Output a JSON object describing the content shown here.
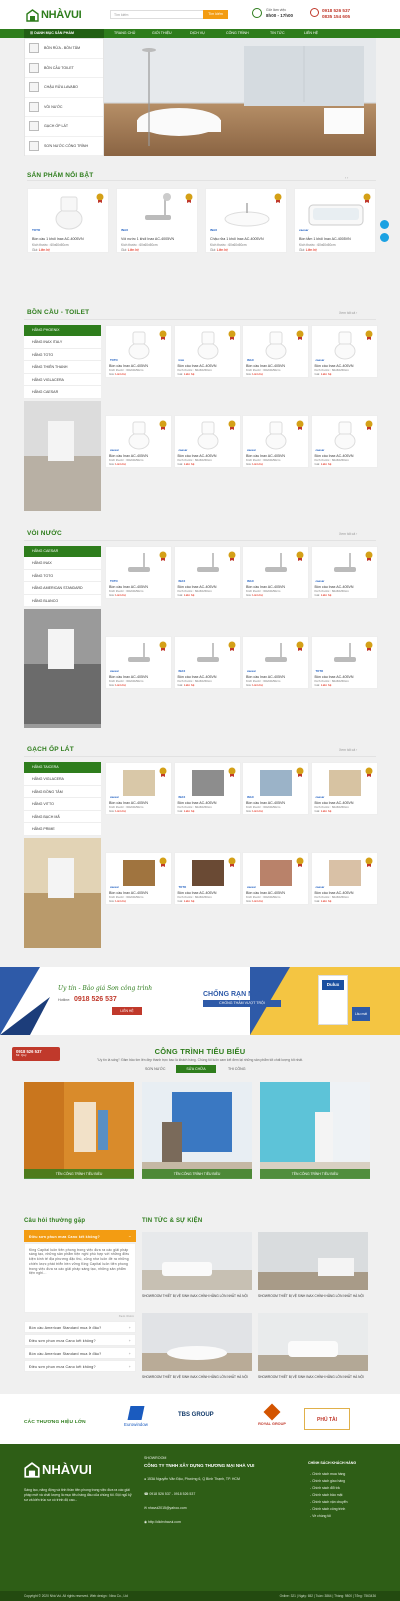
{
  "header": {
    "logo": "NHÀVUI",
    "search_placeholder": "Tìm kiếm",
    "search_button": "Tìm kiếm",
    "hours_label": "Giờ làm việc",
    "hours_value": "8h00 - 17h00",
    "phones": [
      "0918 526 537",
      "0835 154 605"
    ]
  },
  "nav": {
    "category": "DANH MỤC SẢN PHẨM",
    "items": [
      "TRANG CHỦ",
      "GIỚI THIỆU",
      "DỊCH VỤ",
      "CÔNG TRÌNH",
      "TIN TỨC",
      "LIÊN HỆ"
    ]
  },
  "sidebar": {
    "items": [
      "BỒN RỬA - BỒN TẮM",
      "BỒN CẦU TOILET",
      "CHẬU RỬA LAVABO",
      "VÒI NƯỚC",
      "GẠCH ỐP LÁT",
      "SƠN NƯỚC CÔNG TRÌNH"
    ]
  },
  "featured": {
    "title": "SẢN PHẨM NỔI BẬT",
    "products": [
      {
        "name": "Bồn cầu 1 khối Inax AC-4005VN",
        "size": "Kích thước : 60x60x50cm",
        "price_label": "Giá:",
        "price": "Liên hệ",
        "brand": "TOTO"
      },
      {
        "name": "Vòi nước 1 khối Inax AC-4005VN",
        "size": "Kích thước : 60x60x50cm",
        "price_label": "Giá:",
        "price": "Liên hệ",
        "brand": "INAX"
      },
      {
        "name": "Chậu rửa 1 khối Inax AC-4005VN",
        "size": "Kích thước : 60x60x50cm",
        "price_label": "Giá:",
        "price": "Liên hệ",
        "brand": "INAX"
      },
      {
        "name": "Bồn tắm 1 khối Inax AC-4005VN",
        "size": "Kích thước : 60x60x50cm",
        "price_label": "Giá:",
        "price": "Liên hệ",
        "brand": "caesar"
      }
    ]
  },
  "sections": [
    {
      "title": "BỒN CẦU - TOILET",
      "viewall": "Xem tất cả",
      "brands": [
        "HÃNG PHOENIX",
        "HÃNG INAX ITALY",
        "HÃNG TOTO",
        "HÃNG THIÊN THANH",
        "HÃNG VIGLACERA",
        "HÃNG CAESAR"
      ],
      "product_name": "Bồn cầu Inax AC-405VN",
      "size": "Kích thước : 60x60x50cm",
      "price_label": "Giá:",
      "price": "Liên hệ",
      "brand_tags": [
        "TOTO",
        "inax",
        "INAX",
        "caesar",
        "caesar",
        "caesar",
        "caesar",
        "caesar"
      ]
    },
    {
      "title": "VÒI NƯỚC",
      "viewall": "Xem tất cả",
      "brands": [
        "HÃNG CAESAR",
        "HÃNG INAX",
        "HÃNG TOTO",
        "HÃNG AMERICAN STANDARD",
        "HÃNG BLANCO"
      ],
      "product_name": "Bồn cầu Inax AC-405VN",
      "size": "Kích thước : 60x60x50cm",
      "price_label": "Giá:",
      "price": "Liên hệ",
      "brand_tags": [
        "TOTO",
        "INAX",
        "INAX",
        "caesar",
        "caesar",
        "INAX",
        "caesar",
        "TOTO"
      ]
    },
    {
      "title": "GẠCH ỐP LÁT",
      "viewall": "Xem tất cả",
      "brands": [
        "HÃNG TAICERA",
        "HÃNG VIGLACERA",
        "HÃNG ĐỒNG TÂM",
        "HÃNG VITTO",
        "HÃNG BẠCH MÃ",
        "HÃNG PRIME"
      ],
      "product_name": "Bồn cầu Inax AC-405VN",
      "size": "Kích thước : 60x60x50cm",
      "price_label": "Giá:",
      "price": "Liên hệ",
      "brand_tags": [
        "caesar",
        "INAX",
        "INAX",
        "caesar",
        "caesar",
        "TOTO",
        "caesar",
        "caesar"
      ]
    }
  ],
  "promo": {
    "script": "Uy tín - Bảo giá Sơn công trình",
    "hotline_label": "Hotline:",
    "hotline": "0918 526 537",
    "button": "LIÊN HỆ",
    "headline1": "CHỐNG RẠN NỨT",
    "headline2": "CHỐNG THẤM VƯỢT TRỘI",
    "paint_brand": "Dulux",
    "paint_tag": "Lâu mát"
  },
  "hotline_float": {
    "phone": "0918 526 537",
    "name": "Mr. Quý"
  },
  "projects": {
    "title": "CÔNG TRÌNH TIÊU BIỂU",
    "intro": "\"Uy tín là sống\": Đảm bảo tìm lên đẹp thanh trực bao là khách hàng. Chúng tôi luôn cam kết đem lại những sản phẩm tốt chất lượng tốt nhất.",
    "tabs": [
      "SƠN NƯỚC",
      "SỬA CHỮA",
      "THI CÔNG"
    ],
    "captions": [
      "TÊN CÔNG TRÌNH TIÊU BIỂU",
      "TÊN CÔNG TRÌNH TIÊU BIỂU",
      "TÊN CÔNG TRÌNH TIÊU BIỂU"
    ]
  },
  "faq": {
    "title": "Câu hỏi thường gặp",
    "open_q": "Điều sơn phun mưa Cano kết không?",
    "answer": "King Capital luôn tiên phong trong việc đưa ra các giải pháp sáng tạo, những sản phẩm tiện nghi phù hợp với những điều kiện kinh tế địa phương đặc thù, cũng như luôn đề ra những chiến lược phát triển bền vững King Capital luôn tiên phong trong việc đưa ra các giải pháp sáng tạo, những sản phẩm tiện nghi...",
    "more": "Xem thêm",
    "questions": [
      "Bồn cầu American Standard mua ở đâu?",
      "Điều sơn phun mưa Cano kết không?",
      "Bồn cầu American Standard mua ở đâu?",
      "Điều sơn phun mưa Cano kết không?"
    ]
  },
  "news": {
    "title": "TIN TỨC & SỰ KIỆN",
    "items": [
      "SHOWROOM THIẾT BỊ VỆ SINH INAX CHÍNH HÃNG LỚN NHẤT HÀ NỘI",
      "SHOWROOM THIẾT BỊ VỆ SINH INAX CHÍNH HÃNG LỚN NHẤT HÀ NỘI",
      "SHOWROOM THIẾT BỊ VỆ SINH INAX CHÍNH HÃNG LỚN NHẤT HÀ NỘI",
      "SHOWROOM THIẾT BỊ VỆ SINH INAX CHÍNH HÃNG LỚN NHẤT HÀ NỘI"
    ]
  },
  "partners": {
    "title": "CÁC THƯƠNG HIỆU LỚN",
    "logos": [
      "Eurowindow",
      "TBS GROUP",
      "ROYAL GROUP",
      "PHÚ TÀI"
    ]
  },
  "footer": {
    "logo": "NHÀVUI",
    "about": "Sáng tạo, năng động và tinh thần tiên phong trong việc đưa ra các giải pháp mới và chất lượng là mục tiêu hàng đầu của chúng tôi. Đội ngũ kỹ sư và kiến trúc sư có trình độ cao...",
    "showroom_label": "SHOWROOM",
    "company": "CÔNG TY TNHH XÂY DỰNG THƯƠNG MẠI NHÀ VUI",
    "address": "153A Nguyễn Văn Đậu, Phường 6, Q Bình Thạnh, TP. HCM",
    "phone": "0918 526 537 - 0918 526 537",
    "email": "nhavui2015@yahoo.com",
    "web": "http://dichvhavui.com",
    "policy_title": "CHÍNH SÁCH KHÁCH HÀNG",
    "policies": [
      "Chính sách mua hàng",
      "Chính sách giao hàng",
      "Chính sách đổi trả",
      "Chính sách bảo mật",
      "Chính sách vận chuyển",
      "Chính sách công trình",
      "Về chúng tôi"
    ],
    "copyright": "Copyright © 2020 Nhà Vui. All rights reserved. Web design : Nina Co., Ltd",
    "stats": "Online: 321 | Ngày: 652 | Tuần: 3864 | Tháng: 9800 | Tổng: 7563436"
  },
  "colors": {
    "brand_green": "#2e7d1c",
    "accent_orange": "#f39c12",
    "price_red": "#e74c3c"
  }
}
